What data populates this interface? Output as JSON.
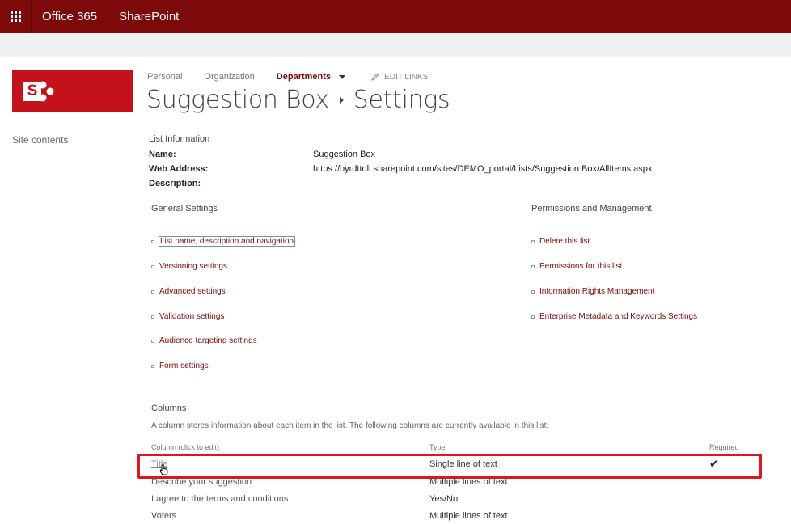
{
  "suitebar": {
    "app": "Office 365",
    "product": "SharePoint"
  },
  "leftnav": {
    "site_contents": "Site contents"
  },
  "topnav": {
    "items": [
      "Personal",
      "Organization",
      "Departments"
    ],
    "edit_links": "EDIT LINKS"
  },
  "title": {
    "list": "Suggestion Box",
    "page": "Settings"
  },
  "list_info": {
    "heading": "List Information",
    "name_label": "Name:",
    "name_value": "Suggestion Box",
    "web_label": "Web Address:",
    "web_value": "https://byrdttoli.sharepoint.com/sites/DEMO_portal/Lists/Suggestion Box/AllItems.aspx",
    "desc_label": "Description:"
  },
  "general_settings": {
    "heading": "General Settings",
    "links": [
      "List name, description and navigation",
      "Versioning settings",
      "Advanced settings",
      "Validation settings",
      "Audience targeting settings",
      "Form settings"
    ]
  },
  "permissions": {
    "heading": "Permissions and Management",
    "links": [
      "Delete this list",
      "Permissions for this list",
      "Information Rights Management",
      "Enterprise Metadata and Keywords Settings"
    ]
  },
  "columns": {
    "heading": "Columns",
    "description": "A column stores information about each item in the list. The following columns are currently available in this list:",
    "headers": {
      "column": "Column (click to edit)",
      "type": "Type",
      "required": "Required"
    },
    "rows": [
      {
        "name": "Title",
        "type": "Single line of text",
        "required": "✔"
      },
      {
        "name": "Describe your suggestion",
        "type": "Multiple lines of text",
        "required": ""
      },
      {
        "name": "I agree to the terms and conditions",
        "type": "Yes/No",
        "required": ""
      },
      {
        "name": "Voters",
        "type": "Multiple lines of text",
        "required": ""
      }
    ]
  },
  "colors": {
    "suitebar": "#7d0a0b",
    "logo": "#c4121a",
    "link": "#7d0a0b",
    "highlight": "#e0161e"
  },
  "icons": {
    "waffle": "app-launcher-icon",
    "edit": "pencil-icon",
    "cursor": "hand-pointer-icon",
    "required": "checkmark-icon"
  }
}
